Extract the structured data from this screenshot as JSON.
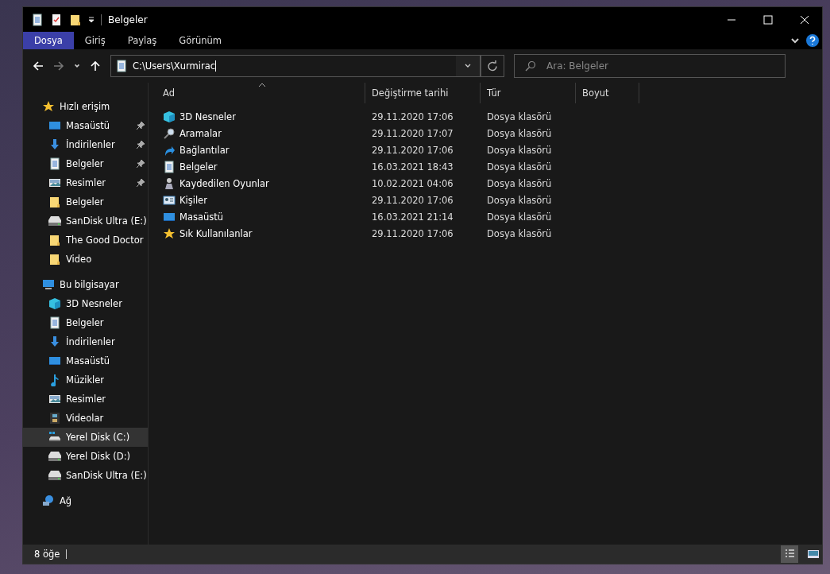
{
  "window": {
    "title": "Belgeler"
  },
  "quick_access_toolbar": [
    {
      "kind": "document"
    },
    {
      "kind": "properties"
    },
    {
      "kind": "folder"
    }
  ],
  "ribbon_tabs": [
    {
      "label": "Dosya",
      "selected": true
    },
    {
      "label": "Giriş",
      "selected": false
    },
    {
      "label": "Paylaş",
      "selected": false
    },
    {
      "label": "Görünüm",
      "selected": false
    }
  ],
  "address_bar": {
    "value": "C:\\Users\\Xurmirac"
  },
  "search": {
    "placeholder": "Ara: Belgeler"
  },
  "sidebar": {
    "sections": [
      {
        "label": "Hızlı erişim",
        "kind": "star",
        "selected": false,
        "children": [
          {
            "label": "Masaüstü",
            "kind": "desktop",
            "pinned": true,
            "selected": false
          },
          {
            "label": "İndirilenler",
            "kind": "download",
            "pinned": true,
            "selected": false
          },
          {
            "label": "Belgeler",
            "kind": "document",
            "pinned": true,
            "selected": false
          },
          {
            "label": "Resimler",
            "kind": "pictures",
            "pinned": true,
            "selected": false
          },
          {
            "label": "Belgeler",
            "kind": "folder",
            "pinned": false,
            "selected": false
          },
          {
            "label": "SanDisk Ultra (E:)",
            "kind": "drive",
            "pinned": false,
            "selected": false
          },
          {
            "label": "The Good Doctor",
            "kind": "folder",
            "pinned": false,
            "selected": false
          },
          {
            "label": "Video",
            "kind": "folder",
            "pinned": false,
            "selected": false
          }
        ]
      },
      {
        "label": "Bu bilgisayar",
        "kind": "computer",
        "selected": false,
        "children": [
          {
            "label": "3D Nesneler",
            "kind": "cube",
            "pinned": false,
            "selected": false
          },
          {
            "label": "Belgeler",
            "kind": "document",
            "pinned": false,
            "selected": false
          },
          {
            "label": "İndirilenler",
            "kind": "download",
            "pinned": false,
            "selected": false
          },
          {
            "label": "Masaüstü",
            "kind": "desktop",
            "pinned": false,
            "selected": false
          },
          {
            "label": "Müzikler",
            "kind": "music",
            "pinned": false,
            "selected": false
          },
          {
            "label": "Resimler",
            "kind": "pictures",
            "pinned": false,
            "selected": false
          },
          {
            "label": "Videolar",
            "kind": "video",
            "pinned": false,
            "selected": false
          },
          {
            "label": "Yerel Disk (C:)",
            "kind": "systemdrive",
            "pinned": false,
            "selected": true
          },
          {
            "label": "Yerel Disk (D:)",
            "kind": "drive",
            "pinned": false,
            "selected": false
          },
          {
            "label": "SanDisk Ultra (E:)",
            "kind": "drive",
            "pinned": false,
            "selected": false
          }
        ]
      },
      {
        "label": "Ağ",
        "kind": "network",
        "selected": false
      }
    ]
  },
  "table": {
    "columns": [
      "Ad",
      "Değiştirme tarihi",
      "Tür",
      "Boyut"
    ],
    "rows": [
      {
        "name": "3D Nesneler",
        "kind": "cube",
        "modified": "29.11.2020 17:06",
        "type": "Dosya klasörü"
      },
      {
        "name": "Aramalar",
        "kind": "search",
        "modified": "29.11.2020 17:07",
        "type": "Dosya klasörü"
      },
      {
        "name": "Bağlantılar",
        "kind": "link",
        "modified": "29.11.2020 17:06",
        "type": "Dosya klasörü"
      },
      {
        "name": "Belgeler",
        "kind": "document",
        "modified": "16.03.2021 18:43",
        "type": "Dosya klasörü"
      },
      {
        "name": "Kaydedilen Oyunlar",
        "kind": "games",
        "modified": "10.02.2021 04:06",
        "type": "Dosya klasörü"
      },
      {
        "name": "Kişiler",
        "kind": "contacts",
        "modified": "29.11.2020 17:06",
        "type": "Dosya klasörü"
      },
      {
        "name": "Masaüstü",
        "kind": "desktop",
        "modified": "16.03.2021 21:14",
        "type": "Dosya klasörü"
      },
      {
        "name": "Sık Kullanılanlar",
        "kind": "star",
        "modified": "29.11.2020 17:06",
        "type": "Dosya klasörü"
      }
    ]
  },
  "status_bar": {
    "item_count": "8 öğe",
    "view_buttons": [
      {
        "kind": "details",
        "selected": true
      },
      {
        "kind": "large_icons",
        "selected": false
      }
    ]
  }
}
